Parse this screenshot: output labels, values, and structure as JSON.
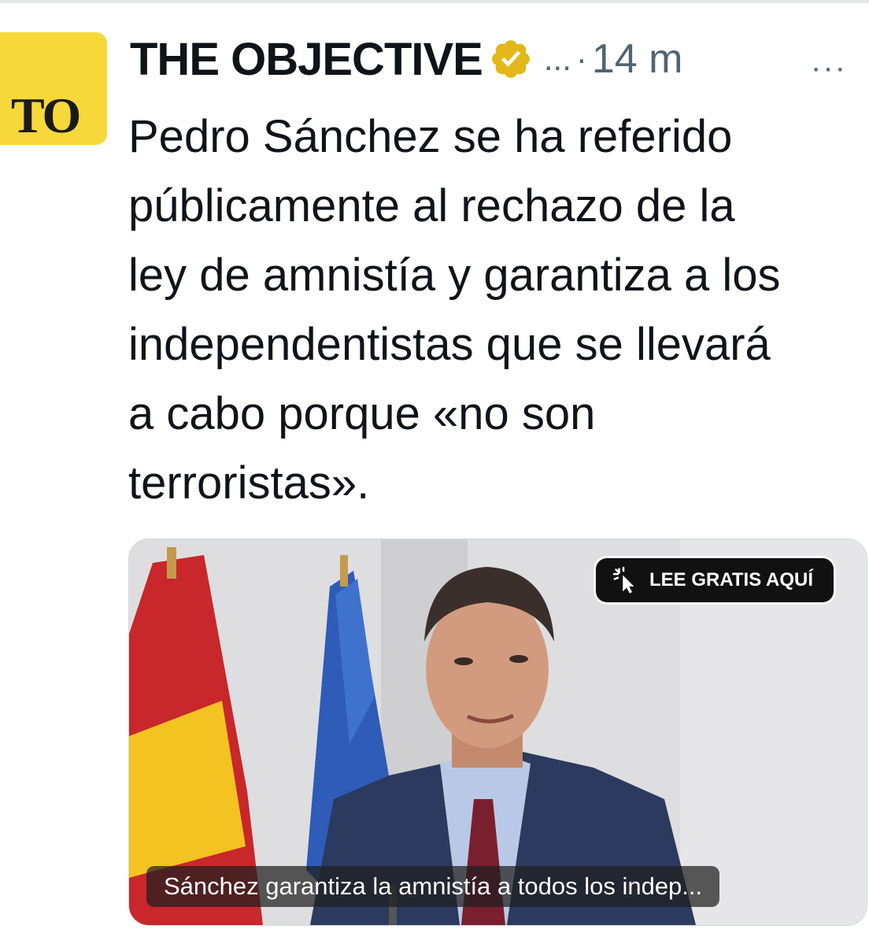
{
  "tweet": {
    "avatar_text": "TO",
    "author_name": "THE OBJECTIVE",
    "handle": "...",
    "separator": "·",
    "time": "14 m",
    "more_label": "···",
    "text_lines": [
      "Pedro Sánchez se ha referido",
      "públicamente al rechazo de la",
      "ley de amnistía y garantiza a los",
      "independentistas que se llevará",
      "a cabo porque «no son",
      "terroristas»."
    ]
  },
  "card": {
    "cta_label": "LEE GRATIS AQUÍ",
    "headline": "Sánchez garantiza la amnistía a todos los indep..."
  },
  "icons": {
    "verified": "verified-gold-badge-icon",
    "more": "more-options-icon",
    "cursor": "click-cursor-icon"
  },
  "colors": {
    "avatar_bg": "#f7d83a",
    "verified_gold": "#e2b719",
    "secondary_text": "#536471"
  }
}
